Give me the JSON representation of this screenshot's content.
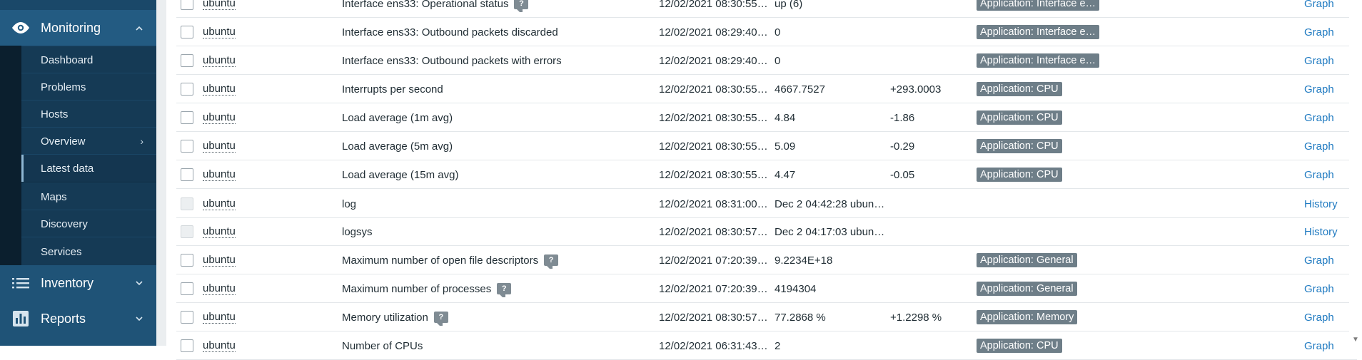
{
  "sidebar": {
    "monitoring": {
      "label": "Monitoring",
      "icon": "eye-icon",
      "chevron": "▲"
    },
    "submenu": [
      {
        "label": "Dashboard"
      },
      {
        "label": "Problems"
      },
      {
        "label": "Hosts"
      },
      {
        "label": "Overview",
        "chevron": "›"
      },
      {
        "label": "Latest data",
        "active": true
      },
      {
        "label": "Maps"
      },
      {
        "label": "Discovery"
      },
      {
        "label": "Services"
      }
    ],
    "inventory": {
      "label": "Inventory",
      "icon": "list-icon",
      "chevron": "⌄"
    },
    "reports": {
      "label": "Reports",
      "icon": "bar-chart-icon",
      "chevron": "⌄"
    }
  },
  "rows": [
    {
      "host": "ubuntu",
      "name": "Interface ens33: Operational status",
      "hint": "?",
      "last_check": "12/02/2021 08:30:55…",
      "last_value": "up (6)",
      "change": "",
      "tag": "Application: Interface e…",
      "action": "Graph",
      "checkbox_disabled": false
    },
    {
      "host": "ubuntu",
      "name": "Interface ens33: Outbound packets discarded",
      "hint": "",
      "last_check": "12/02/2021 08:29:40…",
      "last_value": "0",
      "change": "",
      "tag": "Application: Interface e…",
      "action": "Graph",
      "checkbox_disabled": false
    },
    {
      "host": "ubuntu",
      "name": "Interface ens33: Outbound packets with errors",
      "hint": "",
      "last_check": "12/02/2021 08:29:40…",
      "last_value": "0",
      "change": "",
      "tag": "Application: Interface e…",
      "action": "Graph",
      "checkbox_disabled": false
    },
    {
      "host": "ubuntu",
      "name": "Interrupts per second",
      "hint": "",
      "last_check": "12/02/2021 08:30:55…",
      "last_value": "4667.7527",
      "change": "+293.0003",
      "tag": "Application: CPU",
      "action": "Graph",
      "checkbox_disabled": false
    },
    {
      "host": "ubuntu",
      "name": "Load average (1m avg)",
      "hint": "",
      "last_check": "12/02/2021 08:30:55…",
      "last_value": "4.84",
      "change": "-1.86",
      "tag": "Application: CPU",
      "action": "Graph",
      "checkbox_disabled": false
    },
    {
      "host": "ubuntu",
      "name": "Load average (5m avg)",
      "hint": "",
      "last_check": "12/02/2021 08:30:55…",
      "last_value": "5.09",
      "change": "-0.29",
      "tag": "Application: CPU",
      "action": "Graph",
      "checkbox_disabled": false
    },
    {
      "host": "ubuntu",
      "name": "Load average (15m avg)",
      "hint": "",
      "last_check": "12/02/2021 08:30:55…",
      "last_value": "4.47",
      "change": "-0.05",
      "tag": "Application: CPU",
      "action": "Graph",
      "checkbox_disabled": false
    },
    {
      "host": "ubuntu",
      "name": "log",
      "hint": "",
      "last_check": "12/02/2021 08:31:00…",
      "last_value": "Dec 2 04:42:28 ubun…",
      "change": "",
      "tag": "",
      "action": "History",
      "checkbox_disabled": true
    },
    {
      "host": "ubuntu",
      "name": "logsys",
      "hint": "",
      "last_check": "12/02/2021 08:30:57…",
      "last_value": "Dec 2 04:17:03 ubun…",
      "change": "",
      "tag": "",
      "action": "History",
      "checkbox_disabled": true
    },
    {
      "host": "ubuntu",
      "name": "Maximum number of open file descriptors",
      "hint": "?",
      "last_check": "12/02/2021 07:20:39…",
      "last_value": "9.2234E+18",
      "change": "",
      "tag": "Application: General",
      "action": "Graph",
      "checkbox_disabled": false
    },
    {
      "host": "ubuntu",
      "name": "Maximum number of processes",
      "hint": "?",
      "last_check": "12/02/2021 07:20:39…",
      "last_value": "4194304",
      "change": "",
      "tag": "Application: General",
      "action": "Graph",
      "checkbox_disabled": false
    },
    {
      "host": "ubuntu",
      "name": "Memory utilization",
      "hint": "?",
      "last_check": "12/02/2021 08:30:57…",
      "last_value": "77.2868 %",
      "change": "+1.2298 %",
      "tag": "Application: Memory",
      "action": "Graph",
      "checkbox_disabled": false
    },
    {
      "host": "ubuntu",
      "name": "Number of CPUs",
      "hint": "",
      "last_check": "12/02/2021 06:31:43…",
      "last_value": "2",
      "change": "",
      "tag": "Application: CPU",
      "action": "Graph",
      "checkbox_disabled": false
    }
  ],
  "scrollbar": {
    "down_arrow": "▼"
  },
  "colors": {
    "sidebar_bg": "#1f5377",
    "submenu_bg": "#153a55",
    "tag_bg": "#6e7e88",
    "link": "#1f7ac1"
  }
}
